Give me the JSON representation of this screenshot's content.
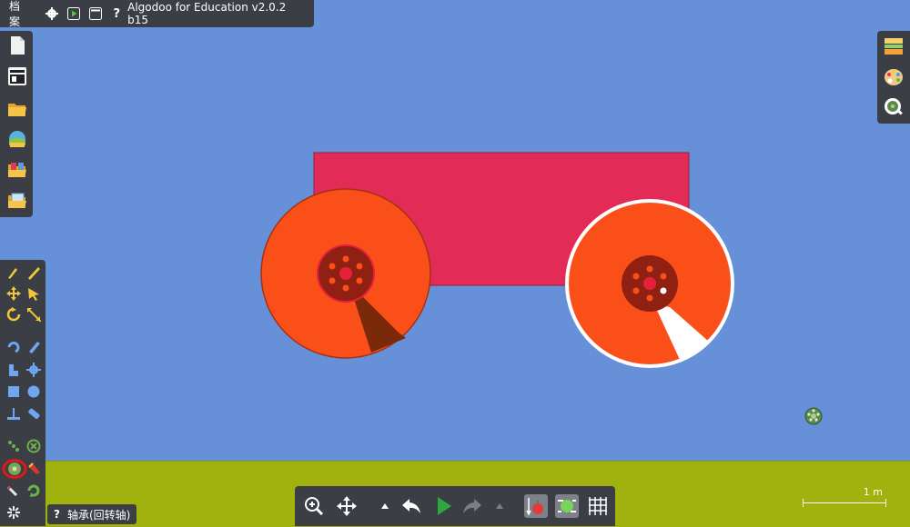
{
  "menu": {
    "file_label": "档案"
  },
  "app": {
    "title": "Algodoo for Education v2.0.2 b15"
  },
  "top_icons": [
    "gear-icon",
    "play-scene-icon",
    "window-icon",
    "help-icon"
  ],
  "help_label": "?",
  "file_toolbar": [
    "new-scene-icon",
    "scene-list-icon",
    "open-folder-icon",
    "load-scene-icon",
    "phunlets-icon",
    "save-folder-icon"
  ],
  "right_toolbar": [
    "layers-icon",
    "palette-icon",
    "magnify-icon"
  ],
  "tools": [
    "sketch-tool",
    "knife-tool",
    "move-tool",
    "drag-tool",
    "rotate-tool",
    "scale-tool",
    "rope-tool",
    "brush-tool",
    "chain-tool",
    "gear-tool",
    "box-tool",
    "circle-tool",
    "plane-tool",
    "spring-tool",
    "fixate-tool",
    "hinge-tool",
    "axle-tool",
    "tracer-tool",
    "laser-tool",
    "thruster-tool",
    "spiral-tool"
  ],
  "tooltip": {
    "icon": "?",
    "text": "轴承(回转轴)"
  },
  "bottom_toolbar": [
    "zoom-icon",
    "pan-icon",
    "undo-menu-icon",
    "undo-icon",
    "play-icon",
    "redo-icon",
    "redo-menu-icon",
    "gravity-icon",
    "air-icon",
    "grid-icon"
  ],
  "scale": {
    "label": "1 m"
  },
  "colors": {
    "sky": "#6690d8",
    "ground": "#a1b20e",
    "body": "#e22c57",
    "wheel": "#fb4f1a",
    "hub": "#8f2012",
    "toolbar": "#3b3f45"
  }
}
